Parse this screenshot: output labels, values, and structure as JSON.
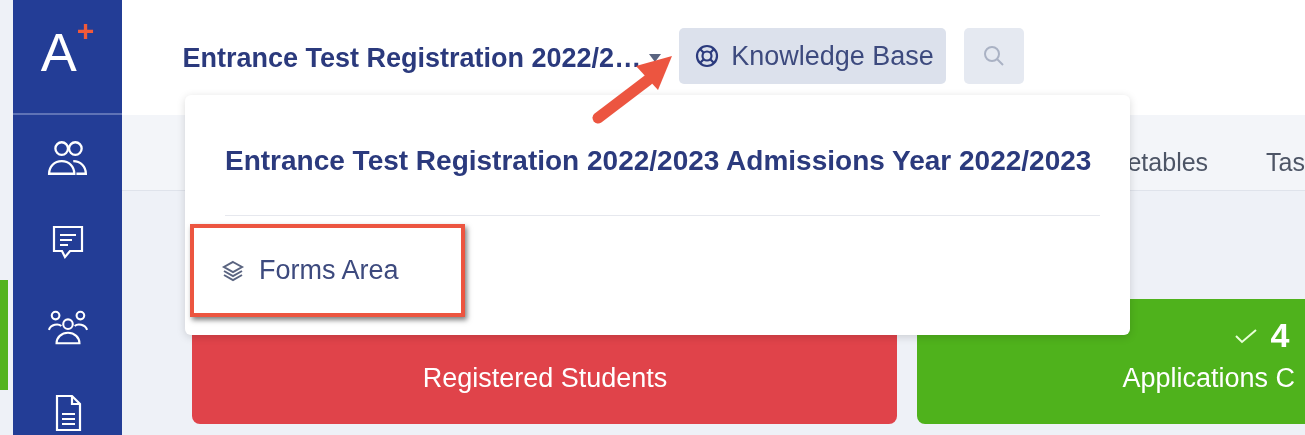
{
  "logo": {
    "letter": "A",
    "mark": "+"
  },
  "header": {
    "title": "Entrance Test Registration 2022/2…",
    "knowledge_base": "Knowledge Base"
  },
  "tabs": [
    {
      "label": "etables"
    },
    {
      "label": "Tas"
    }
  ],
  "dropdown": {
    "title": "Entrance Test Registration 2022/2023 Admissions Year 2022/2023",
    "items": [
      {
        "label": "Forms Area",
        "highlighted": true
      }
    ]
  },
  "cards": [
    {
      "label": "Registered Students",
      "color": "#e0434a"
    },
    {
      "value": "4",
      "label": "Applications C",
      "color": "#4fb21c"
    }
  ]
}
